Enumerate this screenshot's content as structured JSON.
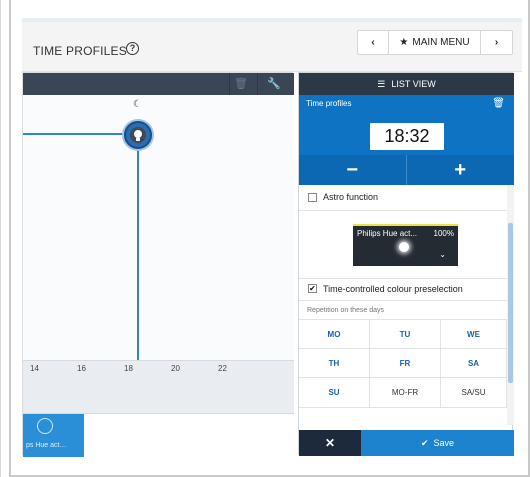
{
  "header": {
    "title": "TIME PROFILES",
    "help_icon": "?",
    "nav": {
      "prev": "‹",
      "main_menu": "MAIN MENU",
      "next": "›"
    }
  },
  "chart": {
    "ticks": [
      "14",
      "16",
      "18",
      "20",
      "22"
    ],
    "moon_icon": "☾",
    "device_label": "ps Hue act…"
  },
  "list_view": {
    "label": "LIST VIEW"
  },
  "profile": {
    "title": "Time profiles",
    "time": "18:32",
    "minus": "−",
    "plus": "+"
  },
  "settings": {
    "astro_label": "Astro function",
    "device_name": "Philips Hue act...",
    "device_percent": "100%",
    "colour_label": "Time-controlled colour preselection",
    "repetition_label": "Repetition on these days",
    "days": [
      "MO",
      "TU",
      "WE",
      "TH",
      "FR",
      "SA",
      "SU",
      "MO-FR",
      "SA/SU"
    ]
  },
  "footer": {
    "cancel": "✕",
    "save": "Save"
  },
  "colors": {
    "accent": "#1d83cf",
    "dark": "#2d3847",
    "line": "#2d86cc"
  }
}
